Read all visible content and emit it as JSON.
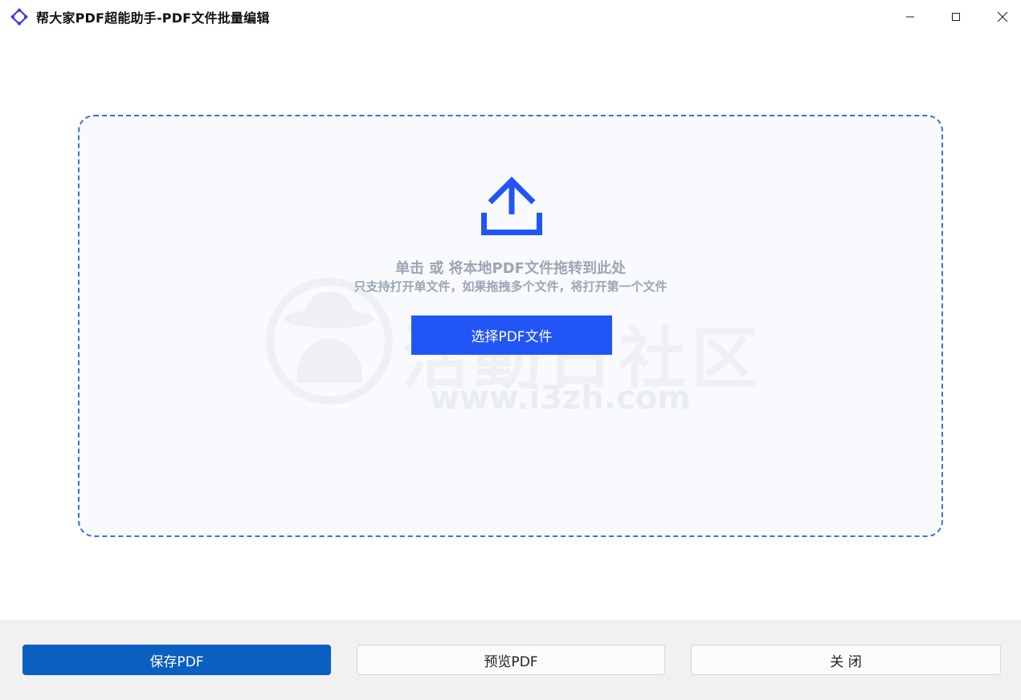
{
  "window": {
    "title": "帮大家PDF超能助手-PDF文件批量编辑",
    "app_icon": "diamond-logo-icon",
    "controls": {
      "minimize_icon": "minimize-icon",
      "maximize_icon": "maximize-icon",
      "close_icon": "close-icon"
    }
  },
  "dropzone": {
    "icon": "upload-icon",
    "hint_main": "单击 或 将本地PDF文件拖转到此处",
    "hint_sub": "只支持打开单文件，如果拖拽多个文件，将打开第一个文件",
    "select_button_label": "选择PDF文件"
  },
  "watermark": {
    "text_cn": "活動日社区",
    "url": "www.i3zh.com"
  },
  "footer": {
    "save_label": "保存PDF",
    "preview_label": "预览PDF",
    "close_label": "关 闭"
  },
  "colors": {
    "accent": "#2255f5",
    "save_button": "#0a5fc0",
    "dropzone_border": "#3d6fd6",
    "hint_text": "#9ca6b4"
  }
}
